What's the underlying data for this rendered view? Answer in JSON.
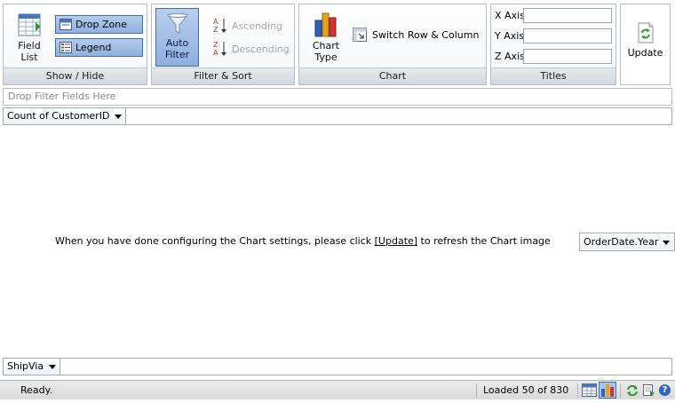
{
  "ribbon": {
    "show_hide": {
      "label": "Show / Hide",
      "field_list_line1": "Field",
      "field_list_line2": "List",
      "drop_zone": "Drop Zone",
      "legend": "Legend"
    },
    "filter_sort": {
      "label": "Filter & Sort",
      "auto_filter_line1": "Auto",
      "auto_filter_line2": "Filter",
      "ascending": "Ascending",
      "descending": "Descending"
    },
    "chart": {
      "label": "Chart",
      "chart_type_line1": "Chart",
      "chart_type_line2": "Type",
      "switch": "Switch Row & Column"
    },
    "titles": {
      "label": "Titles",
      "x_axis": "X Axis",
      "y_axis": "Y Axis",
      "z_axis": "Z Axis",
      "x_value": "",
      "y_value": "",
      "z_value": ""
    },
    "update": "Update"
  },
  "filter_zone": {
    "placeholder": "Drop Filter Fields Here"
  },
  "data_field": {
    "label": "Count of CustomerID"
  },
  "chart_area": {
    "message_before": "When you have done configuring the Chart settings, please click ",
    "message_link": "[Update]",
    "message_after": " to refresh the Chart image",
    "series_field": "OrderDate.Year"
  },
  "category_field": {
    "label": "ShipVia"
  },
  "status": {
    "text": "Ready.",
    "loaded": "Loaded 50 of 830"
  },
  "colors": {
    "ribbon_border": "#b7bcc6",
    "toggle_active": "#8fb0de",
    "status_bg": "#d9d9d9"
  }
}
